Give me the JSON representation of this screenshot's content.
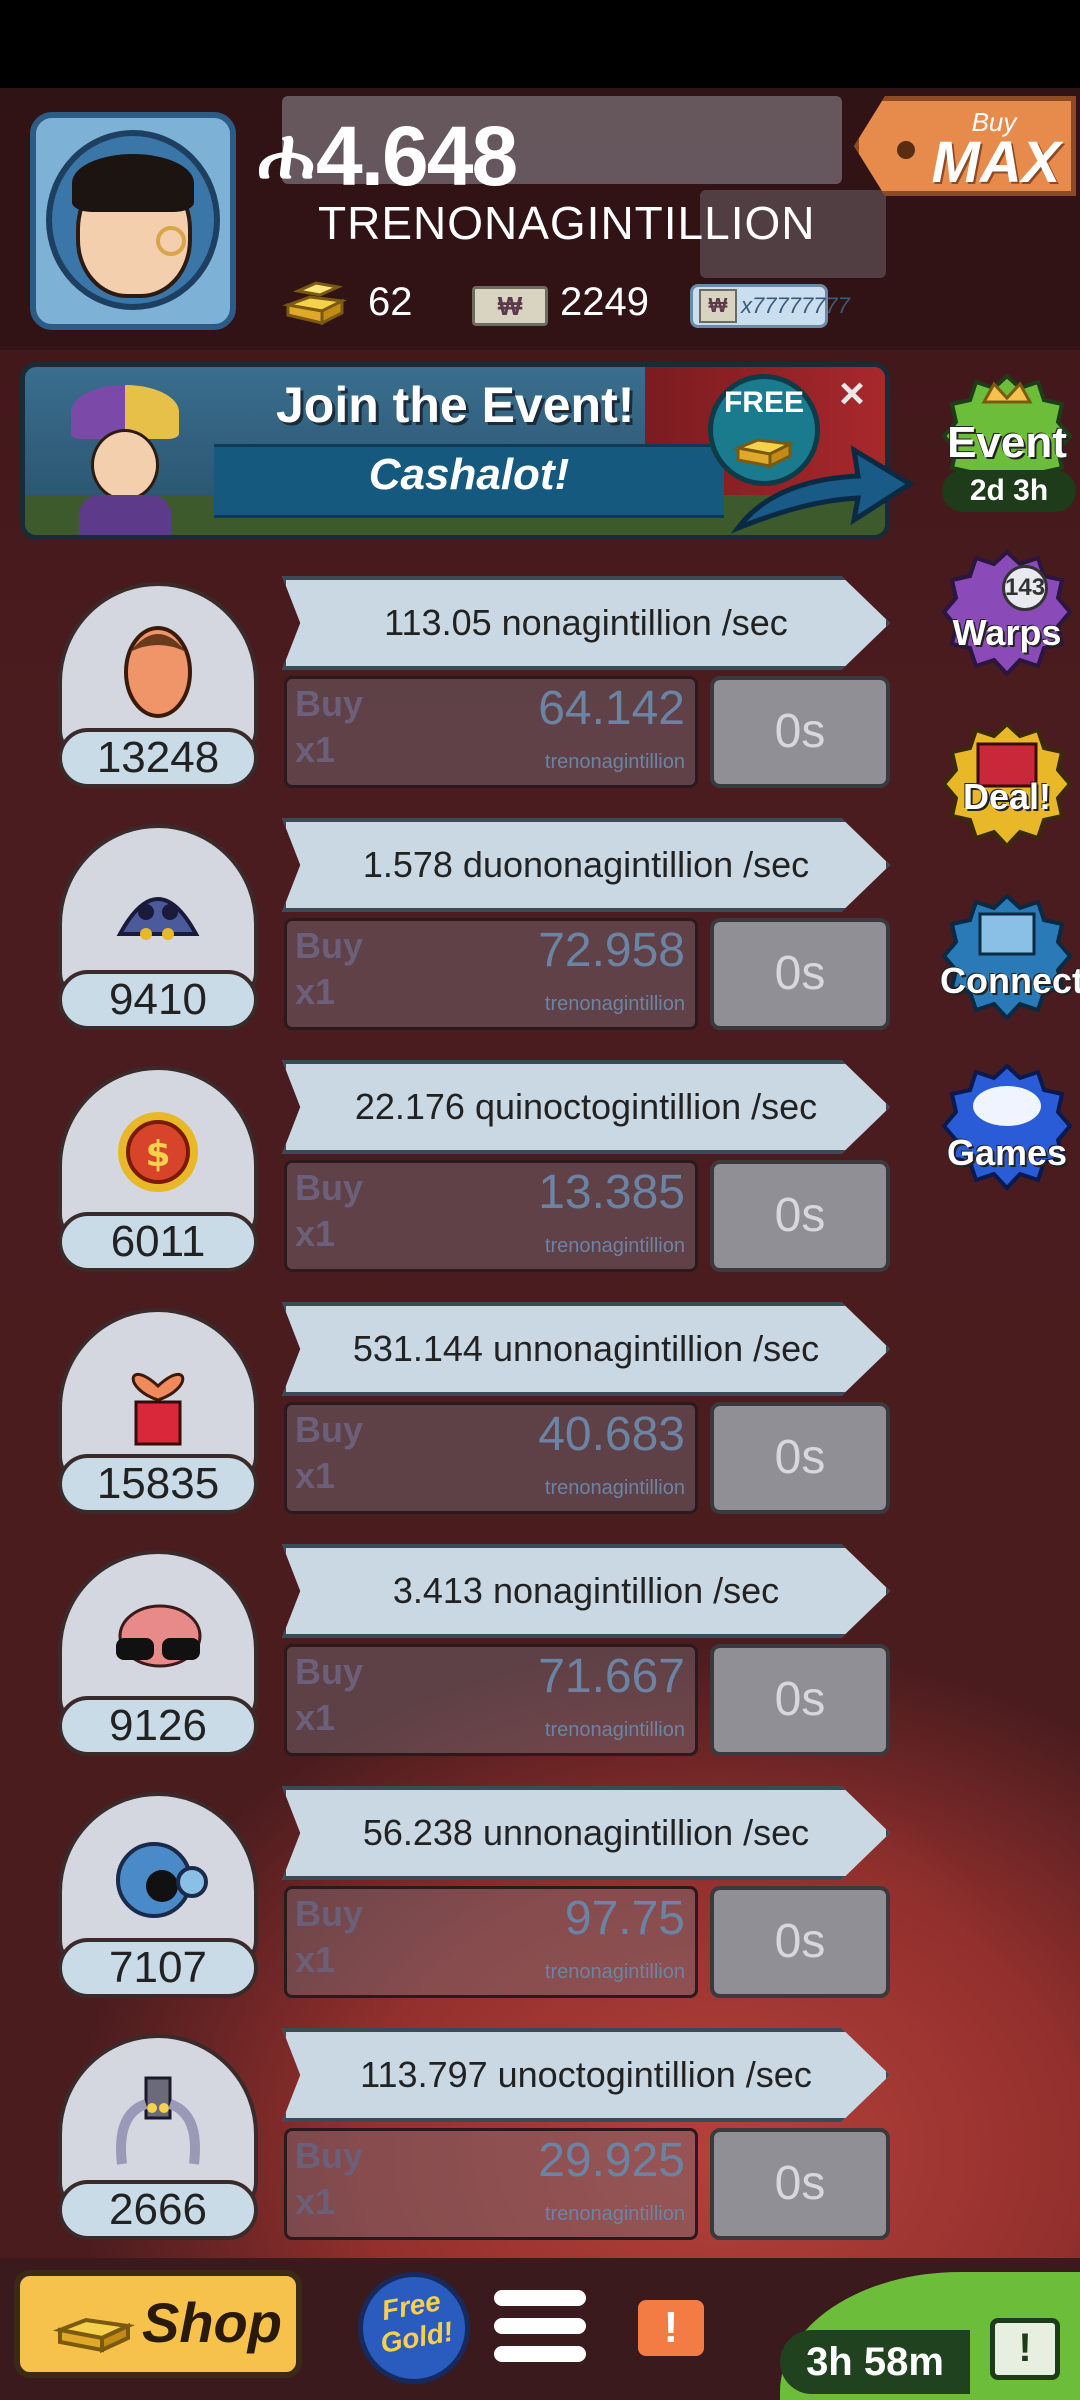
{
  "header": {
    "money_symbol": "ሐ",
    "money_value": "4.648",
    "money_unit": "TRENONAGINTILLION",
    "gold_count": "62",
    "megabucks_symbol": "₩",
    "megabucks_count": "2249",
    "multiplier_text": "x77777777",
    "buymax_buy": "Buy",
    "buymax_max": "MAX"
  },
  "event_banner": {
    "title": "Join the Event!",
    "event_name": "Cashalot!",
    "free_label": "FREE",
    "close": "×"
  },
  "side_buttons": {
    "event_label": "Event",
    "event_timer": "2d 3h",
    "warps_label": "Warps",
    "warps_count": "143",
    "deal_label": "Deal!",
    "connect_label": "Connect",
    "games_label": "Games"
  },
  "rows": [
    {
      "count": "13248",
      "rate": "113.05 nonagintillion /sec",
      "buy": "Buy",
      "qty": "x1",
      "cost": "64.142",
      "cost_unit": "trenonagintillion",
      "time": "0s"
    },
    {
      "count": "9410",
      "rate": "1.578 duononagintillion /sec",
      "buy": "Buy",
      "qty": "x1",
      "cost": "72.958",
      "cost_unit": "trenonagintillion",
      "time": "0s"
    },
    {
      "count": "6011",
      "rate": "22.176 quinoctogintillion /sec",
      "buy": "Buy",
      "qty": "x1",
      "cost": "13.385",
      "cost_unit": "trenonagintillion",
      "time": "0s"
    },
    {
      "count": "15835",
      "rate": "531.144 unnonagintillion /sec",
      "buy": "Buy",
      "qty": "x1",
      "cost": "40.683",
      "cost_unit": "trenonagintillion",
      "time": "0s"
    },
    {
      "count": "9126",
      "rate": "3.413 nonagintillion /sec",
      "buy": "Buy",
      "qty": "x1",
      "cost": "71.667",
      "cost_unit": "trenonagintillion",
      "time": "0s"
    },
    {
      "count": "7107",
      "rate": "56.238 unnonagintillion /sec",
      "buy": "Buy",
      "qty": "x1",
      "cost": "97.75",
      "cost_unit": "trenonagintillion",
      "time": "0s"
    },
    {
      "count": "2666",
      "rate": "113.797 unoctogintillion /sec",
      "buy": "Buy",
      "qty": "x1",
      "cost": "29.925",
      "cost_unit": "trenonagintillion",
      "time": "0s"
    }
  ],
  "bottom_bar": {
    "shop_label": "Shop",
    "free_gold_label": "Free Gold!",
    "alert_symbol": "!",
    "tv_timer": "3h 58m",
    "tv_symbol": "!"
  },
  "colors": {
    "background": "#4a1c1e",
    "rate_bar": "#c9d8e3",
    "shop_button": "#f6c24c",
    "event_green": "#6cbd3a",
    "buymax_orange": "#e78b4c"
  },
  "icons": {
    "gold": "gold-bars-icon",
    "megabucks": "megabucks-icon",
    "menu": "hamburger-menu-icon",
    "alert": "exclamation-icon",
    "tv": "tv-icon"
  }
}
